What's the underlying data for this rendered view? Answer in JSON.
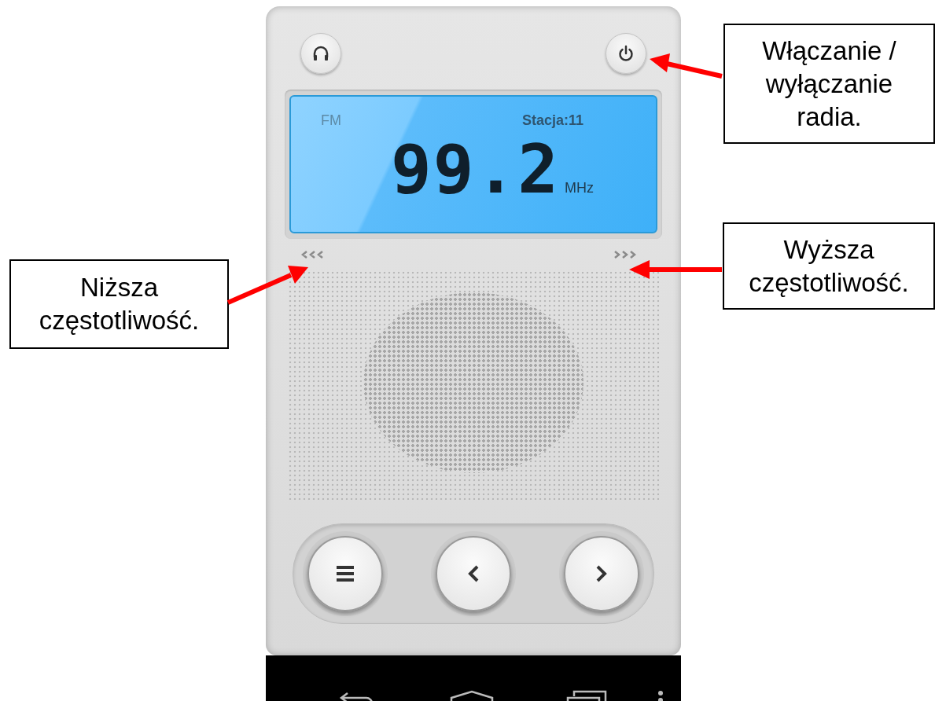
{
  "radio": {
    "band": "FM",
    "station": "Stacja:11",
    "frequency": "99.2",
    "unit": "MHz"
  },
  "callouts": [
    {
      "text": "Włączanie / wyłączanie radia."
    },
    {
      "text": "Wyższa częstotliwość."
    },
    {
      "text": "Niższa częstotliwość."
    }
  ]
}
